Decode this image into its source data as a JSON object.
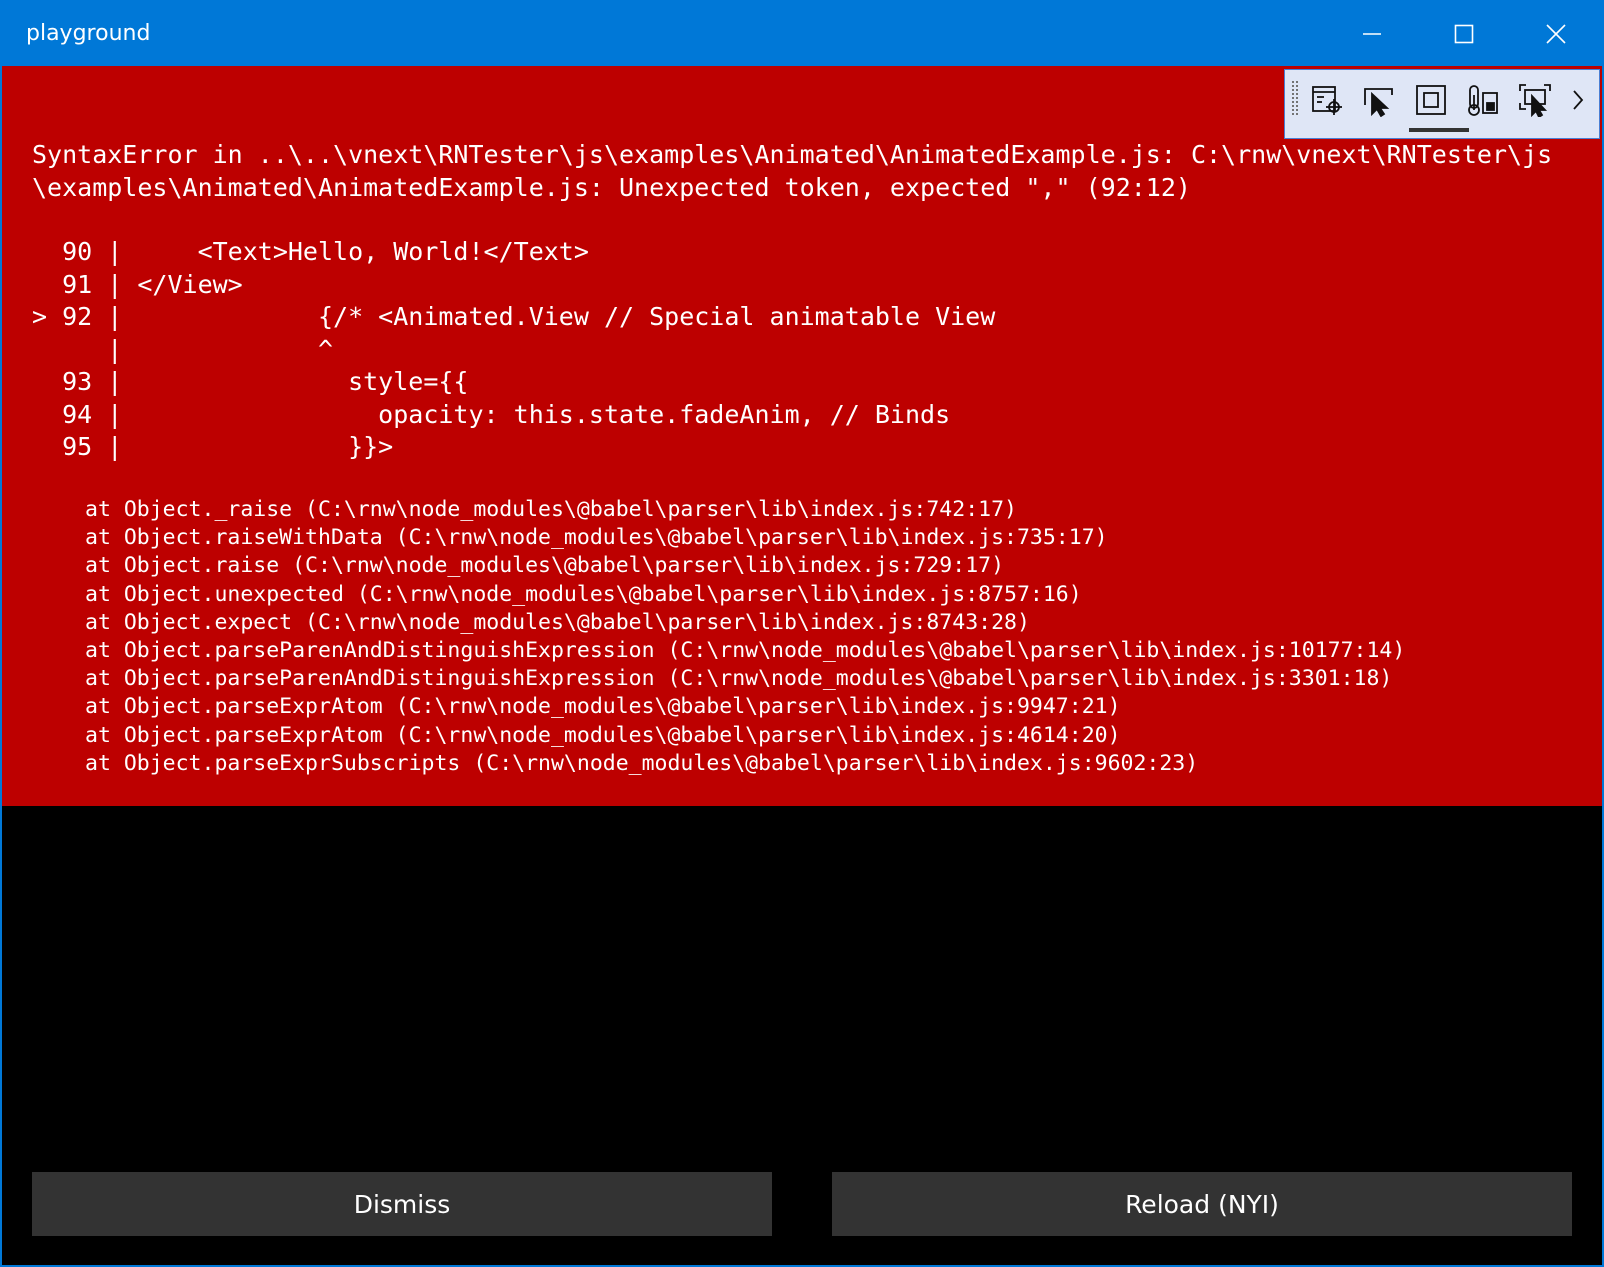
{
  "window": {
    "title": "playground",
    "controls": [
      "minimize-icon",
      "maximize-icon",
      "close-icon"
    ]
  },
  "toolbar": {
    "tools": [
      "visual-tree-icon",
      "select-element-icon",
      "display-layout-adorners-icon",
      "track-focus-icon",
      "preview-selection-icon"
    ],
    "expand": "chevron-right-icon"
  },
  "error": {
    "message": "SyntaxError in ..\\..\\vnext\\RNTester\\js\\examples\\Animated\\AnimatedExample.js: C:\\rnw\\vnext\\RNTester\\js\\examples\\Animated\\AnimatedExample.js: Unexpected token, expected \",\" (92:12)",
    "code_frame": [
      "  90 |     <Text>Hello, World!</Text>",
      "  91 | </View>",
      "> 92 |             {/* <Animated.View // Special animatable View",
      "     |             ^",
      "  93 |               style={{",
      "  94 |                 opacity: this.state.fadeAnim, // Binds",
      "  95 |               }}>"
    ],
    "stack": [
      "at Object._raise (C:\\rnw\\node_modules\\@babel\\parser\\lib\\index.js:742:17)",
      "at Object.raiseWithData (C:\\rnw\\node_modules\\@babel\\parser\\lib\\index.js:735:17)",
      "at Object.raise (C:\\rnw\\node_modules\\@babel\\parser\\lib\\index.js:729:17)",
      "at Object.unexpected (C:\\rnw\\node_modules\\@babel\\parser\\lib\\index.js:8757:16)",
      "at Object.expect (C:\\rnw\\node_modules\\@babel\\parser\\lib\\index.js:8743:28)",
      "at Object.parseParenAndDistinguishExpression (C:\\rnw\\node_modules\\@babel\\parser\\lib\\index.js:10177:14)",
      "at Object.parseParenAndDistinguishExpression (C:\\rnw\\node_modules\\@babel\\parser\\lib\\index.js:3301:18)",
      "at Object.parseExprAtom (C:\\rnw\\node_modules\\@babel\\parser\\lib\\index.js:9947:21)",
      "at Object.parseExprAtom (C:\\rnw\\node_modules\\@babel\\parser\\lib\\index.js:4614:20)",
      "at Object.parseExprSubscripts (C:\\rnw\\node_modules\\@babel\\parser\\lib\\index.js:9602:23)"
    ]
  },
  "buttons": {
    "dismiss": "Dismiss",
    "reload": "Reload (NYI)"
  },
  "colors": {
    "titlebar": "#0078d7",
    "error_background": "#bd0000",
    "body_background": "#000000",
    "button_background": "#333333",
    "toolbar_background": "#dfe6f6"
  }
}
